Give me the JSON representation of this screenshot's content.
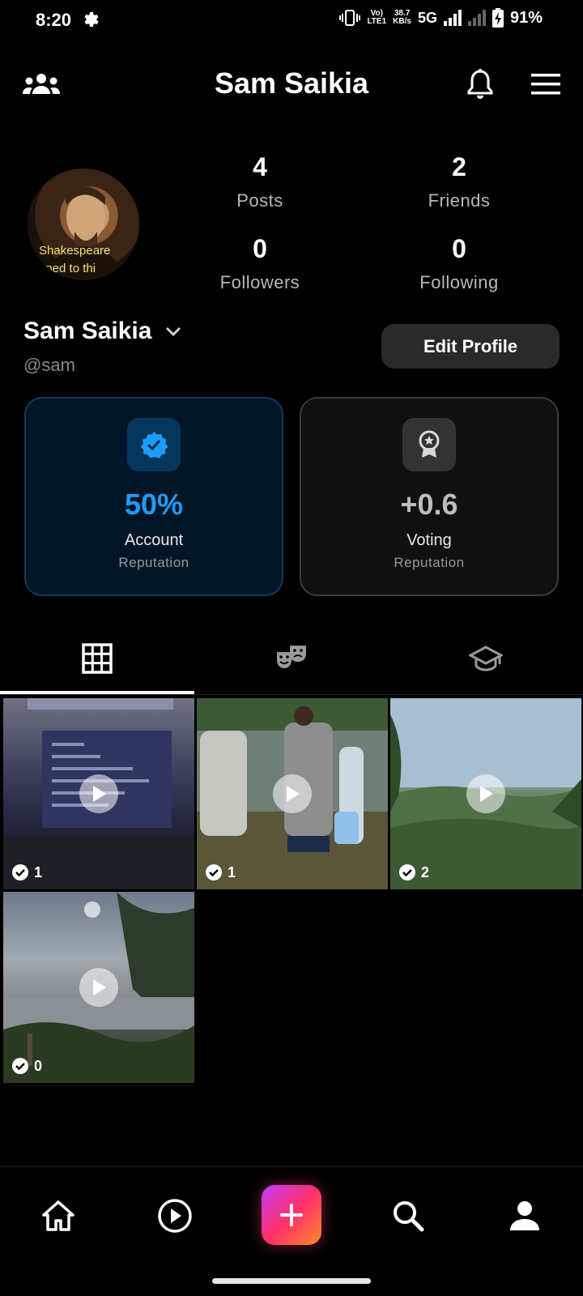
{
  "status_bar": {
    "time": "8:20",
    "lte_top": "Vo)",
    "lte_bottom": "LTE1",
    "speed_top": "38.7",
    "speed_bottom": "KB/s",
    "network": "5G",
    "battery": "91%"
  },
  "header": {
    "title": "Sam Saikia"
  },
  "profile": {
    "avatar_caption": "Shakespeare",
    "avatar_caption2": "oned to thi",
    "display_name": "Sam Saikia",
    "handle": "@sam",
    "edit_label": "Edit Profile",
    "stats": {
      "posts": {
        "value": "4",
        "label": "Posts"
      },
      "friends": {
        "value": "2",
        "label": "Friends"
      },
      "followers": {
        "value": "0",
        "label": "Followers"
      },
      "following": {
        "value": "0",
        "label": "Following"
      }
    }
  },
  "reputation": {
    "account": {
      "value": "50%",
      "label": "Account",
      "sub": "Reputation",
      "accent": "#1e9bff"
    },
    "voting": {
      "value": "+0.6",
      "label": "Voting",
      "sub": "Reputation"
    }
  },
  "tabs": [
    {
      "icon": "grid-icon",
      "active": true
    },
    {
      "icon": "theater-masks-icon",
      "active": false
    },
    {
      "icon": "graduation-cap-icon",
      "active": false
    }
  ],
  "posts": [
    {
      "verified_count": "1"
    },
    {
      "verified_count": "1"
    },
    {
      "verified_count": "2"
    },
    {
      "verified_count": "0"
    }
  ],
  "bottom_nav": [
    "home-icon",
    "play-circle-icon",
    "add-icon",
    "search-icon",
    "person-icon"
  ]
}
